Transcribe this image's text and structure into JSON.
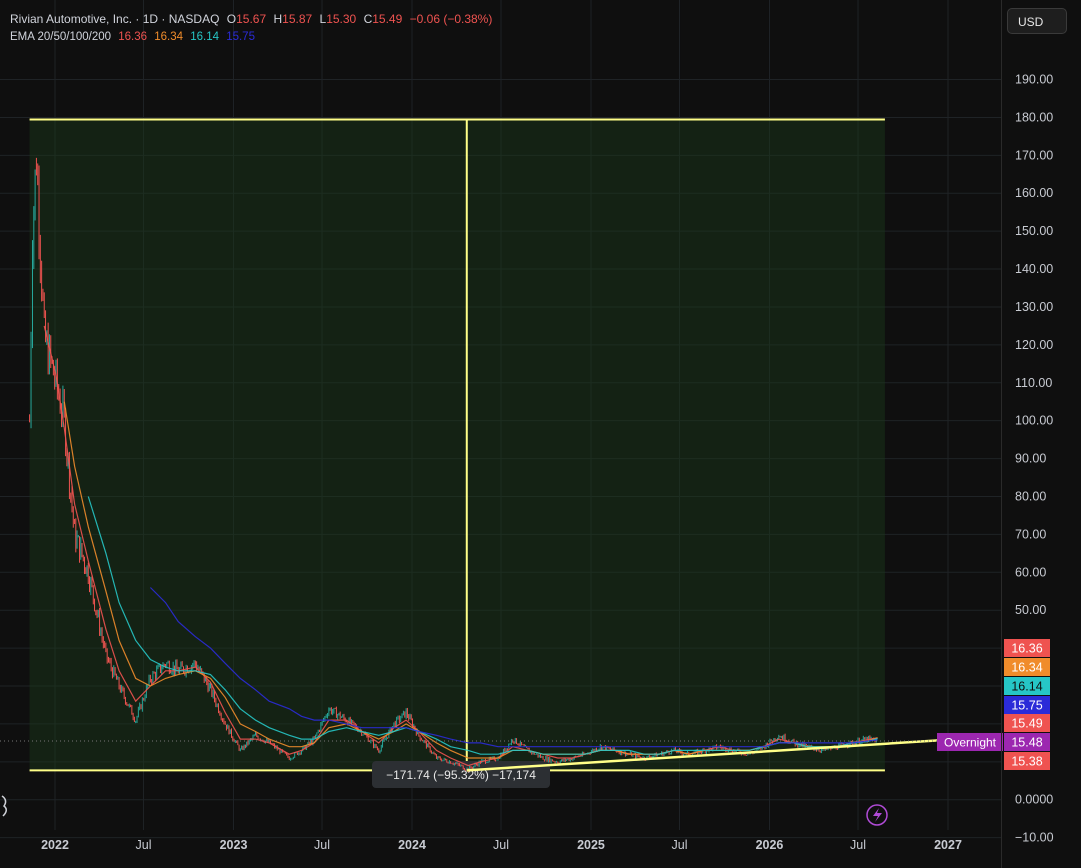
{
  "header": {
    "symbol_name": "Rivian Automotive, Inc. · 1D · NASDAQ",
    "open_label": "O",
    "open": "15.67",
    "high_label": "H",
    "high": "15.87",
    "low_label": "L",
    "low": "15.30",
    "close_label": "C",
    "close": "15.49",
    "change": "−0.06 (−0.38%)",
    "ema_label": "EMA 20/50/100/200",
    "ema_values": [
      "16.36",
      "16.34",
      "16.14",
      "15.75"
    ]
  },
  "currency_button": "USD",
  "measure_label": "−171.74 (−95.32%) −17,174",
  "overnight_label": "Overnight",
  "colors": {
    "background": "#0f0f0f",
    "up": "#26a69a",
    "down": "#ef5350",
    "ema20": "#ef5350",
    "ema50": "#f08c2b",
    "ema100": "#26c6c6",
    "ema200": "#2b2bd8",
    "measure": "#ffff88",
    "overnight": "#9c27b0"
  },
  "chart_data": {
    "type": "line",
    "title": "Rivian Automotive, Inc. · 1D · NASDAQ",
    "x_ticks": [
      "2022",
      "Jul",
      "2023",
      "Jul",
      "2024",
      "Jul",
      "2025",
      "Jul",
      "2026",
      "Jul",
      "2027"
    ],
    "y_ticks": [
      "190.00",
      "180.00",
      "170.00",
      "160.00",
      "150.00",
      "140.00",
      "130.00",
      "120.00",
      "110.00",
      "100.00",
      "90.00",
      "80.00",
      "70.00",
      "60.00",
      "50.00",
      "40.00",
      "30.00",
      "20.00",
      "10.00",
      "0.0000",
      "−10.00"
    ],
    "ylim": [
      -13,
      197
    ],
    "x": [
      "2021-11-10",
      "2021-11-16",
      "2021-11-24",
      "2021-12-10",
      "2022-01-03",
      "2022-01-20",
      "2022-02-10",
      "2022-03-10",
      "2022-04-15",
      "2022-05-12",
      "2022-06-15",
      "2022-07-15",
      "2022-08-15",
      "2022-09-10",
      "2022-10-15",
      "2022-11-15",
      "2022-12-15",
      "2023-01-15",
      "2023-02-15",
      "2023-03-15",
      "2023-04-25",
      "2023-05-20",
      "2023-06-15",
      "2023-07-15",
      "2023-08-20",
      "2023-09-20",
      "2023-10-25",
      "2023-11-25",
      "2023-12-20",
      "2024-01-15",
      "2024-02-20",
      "2024-03-20",
      "2024-04-25",
      "2024-05-20",
      "2024-06-25",
      "2024-07-25",
      "2024-08-25",
      "2024-09-25",
      "2024-10-25",
      "2024-11-25",
      "2024-12-20",
      "2025-01-20",
      "2025-02-20",
      "2025-03-20",
      "2025-04-20",
      "2025-05-20",
      "2025-06-20",
      "2025-07-20",
      "2025-08-20",
      "2025-09-20",
      "2025-10-20",
      "2025-11-20",
      "2025-12-20",
      "2026-01-20",
      "2026-02-20",
      "2026-03-20",
      "2026-04-20",
      "2026-05-20",
      "2026-06-20",
      "2026-07-20",
      "2026-08-10"
    ],
    "series": [
      {
        "name": "Close",
        "values": [
          100,
          150,
          170,
          122,
          110,
          100,
          70,
          60,
          38,
          30,
          21,
          32,
          36,
          34,
          36,
          29,
          20,
          13,
          17,
          15,
          11,
          13,
          16,
          24,
          21,
          18,
          13,
          20,
          23,
          17,
          11,
          10,
          8,
          10,
          11,
          16,
          13,
          11,
          10,
          11,
          12,
          14,
          13,
          12,
          11,
          12,
          13,
          12,
          13,
          14,
          13,
          12,
          14,
          17,
          15,
          14,
          13,
          14,
          15,
          16,
          15.49
        ]
      },
      {
        "name": "EMA 20",
        "values": [
          null,
          null,
          null,
          125,
          112,
          98,
          78,
          63,
          45,
          34,
          26,
          30,
          34,
          34,
          35,
          31,
          23,
          16,
          16,
          15,
          12,
          13,
          15,
          21,
          21,
          18,
          15,
          19,
          21,
          18,
          13,
          11,
          9,
          10,
          11,
          14,
          13,
          12,
          11,
          11,
          12,
          13,
          13,
          12,
          12,
          12,
          13,
          12,
          13,
          14,
          13,
          13,
          14,
          16,
          15,
          14,
          14,
          14,
          15,
          15.8,
          16.36
        ]
      },
      {
        "name": "EMA 50",
        "values": [
          null,
          null,
          null,
          null,
          null,
          105,
          88,
          72,
          55,
          42,
          32,
          30,
          32,
          33,
          34,
          32,
          27,
          20,
          18,
          16,
          14,
          14,
          15,
          19,
          20,
          18,
          16,
          18,
          20,
          18,
          15,
          13,
          11,
          11,
          11,
          13,
          13,
          12,
          12,
          12,
          12,
          13,
          13,
          12,
          12,
          12,
          13,
          12,
          13,
          13,
          13,
          13,
          14,
          15,
          15,
          14,
          14,
          14,
          15,
          15.5,
          16.34
        ]
      },
      {
        "name": "EMA 100",
        "values": [
          null,
          null,
          null,
          null,
          null,
          null,
          null,
          80,
          65,
          52,
          42,
          37,
          35,
          34,
          34,
          33,
          29,
          24,
          21,
          19,
          17,
          16,
          16,
          18,
          19,
          18,
          17,
          18,
          19,
          18,
          16,
          14,
          13,
          12,
          12,
          13,
          13,
          12,
          12,
          12,
          12,
          13,
          13,
          13,
          12,
          12,
          13,
          13,
          13,
          13,
          13,
          13,
          14,
          15,
          15,
          14,
          14,
          14,
          15,
          15.3,
          16.14
        ]
      },
      {
        "name": "EMA 200",
        "values": [
          null,
          null,
          null,
          null,
          null,
          null,
          null,
          null,
          null,
          null,
          null,
          56,
          52,
          47,
          43,
          40,
          36,
          32,
          29,
          26,
          24,
          22,
          21,
          21,
          20,
          19,
          19,
          19,
          19,
          18,
          17,
          16,
          15,
          15,
          14,
          14,
          14,
          14,
          14,
          14,
          14,
          14,
          14,
          14,
          14,
          14,
          14,
          14,
          14,
          14,
          14,
          14,
          14,
          15,
          15,
          15,
          15,
          15,
          15,
          15.5,
          15.75
        ]
      }
    ],
    "price_labels": [
      {
        "text": "16.36",
        "value": 16.36,
        "color": "#ef5350"
      },
      {
        "text": "16.34",
        "value": 16.34,
        "color": "#f08c2b"
      },
      {
        "text": "16.14",
        "value": 16.14,
        "color": "#26c6c6"
      },
      {
        "text": "15.75",
        "value": 15.75,
        "color": "#2b2bd8"
      },
      {
        "text": "15.49",
        "value": 15.49,
        "color": "#ef5350"
      },
      {
        "text": "15.48",
        "value": 15.48,
        "color": "#9c27b0"
      },
      {
        "text": "15.38",
        "value": 15.38,
        "color": "#ef5350"
      }
    ],
    "measure": {
      "date_start": "2021-11-10",
      "date_pick": "2024-04-22",
      "date_end": "2026-08-25",
      "price_high": 179.47,
      "price_low": 7.73
    },
    "trendline": {
      "date_start": "2024-04-22",
      "value_start": 7.73,
      "date_end": "2027-01-05",
      "value_end": 16.7
    },
    "grid": true
  }
}
